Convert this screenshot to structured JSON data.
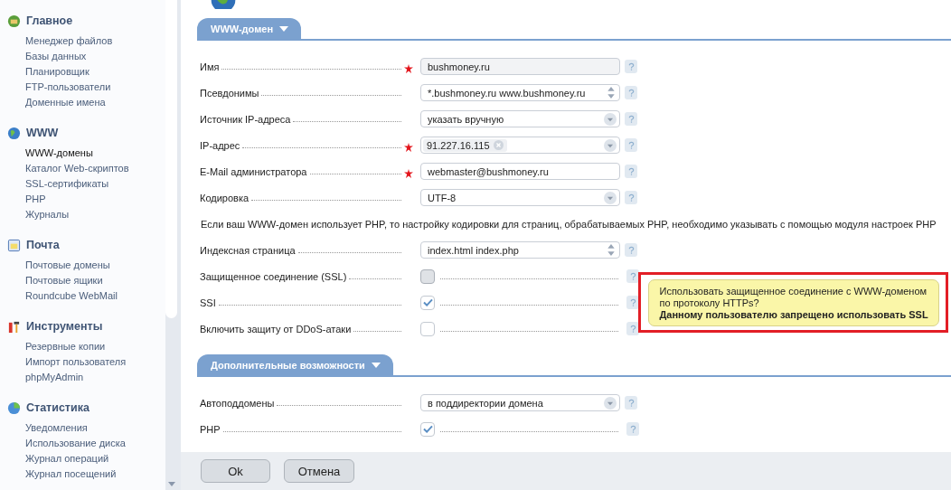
{
  "sidebar": {
    "groups": [
      {
        "title": "Главное",
        "items": [
          {
            "label": "Менеджер файлов",
            "selected": false
          },
          {
            "label": "Базы данных",
            "selected": false
          },
          {
            "label": "Планировщик",
            "selected": false
          },
          {
            "label": "FTP-пользователи",
            "selected": false
          },
          {
            "label": "Доменные имена",
            "selected": false
          }
        ]
      },
      {
        "title": "WWW",
        "items": [
          {
            "label": "WWW-домены",
            "selected": true
          },
          {
            "label": "Каталог Web-скриптов",
            "selected": false
          },
          {
            "label": "SSL-сертификаты",
            "selected": false
          },
          {
            "label": "PHP",
            "selected": false
          },
          {
            "label": "Журналы",
            "selected": false
          }
        ]
      },
      {
        "title": "Почта",
        "items": [
          {
            "label": "Почтовые домены",
            "selected": false
          },
          {
            "label": "Почтовые ящики",
            "selected": false
          },
          {
            "label": "Roundcube WebMail",
            "selected": false
          }
        ]
      },
      {
        "title": "Инструменты",
        "items": [
          {
            "label": "Резервные копии",
            "selected": false
          },
          {
            "label": "Импорт пользователя",
            "selected": false
          },
          {
            "label": "phpMyAdmin",
            "selected": false
          }
        ]
      },
      {
        "title": "Статистика",
        "items": [
          {
            "label": "Уведомления",
            "selected": false
          },
          {
            "label": "Использование диска",
            "selected": false
          },
          {
            "label": "Журнал операций",
            "selected": false
          },
          {
            "label": "Журнал посещений",
            "selected": false
          }
        ]
      }
    ]
  },
  "sections": [
    {
      "title": "WWW-домен",
      "fields": [
        {
          "kind": "text",
          "label": "Имя",
          "required": true,
          "value": "bushmoney.ru",
          "disabled": true
        },
        {
          "kind": "list",
          "label": "Псевдонимы",
          "required": false,
          "value": "*.bushmoney.ru www.bushmoney.ru"
        },
        {
          "kind": "select",
          "label": "Источник IP-адреса",
          "required": false,
          "value": "указать вручную"
        },
        {
          "kind": "tags",
          "label": "IP-адрес",
          "required": true,
          "value": "91.227.16.115"
        },
        {
          "kind": "text",
          "label": "E-Mail администратора",
          "required": true,
          "value": "webmaster@bushmoney.ru",
          "disabled": false
        },
        {
          "kind": "select",
          "label": "Кодировка",
          "required": false,
          "value": "UTF-8"
        },
        {
          "kind": "note",
          "label": "Если ваш WWW-домен использует PHP, то настройку кодировки для страниц, обрабатываемых PHP, необходимо указывать с помощью модуля настроек PHP"
        },
        {
          "kind": "list",
          "label": "Индексная страница",
          "required": false,
          "value": "index.html index.php"
        },
        {
          "kind": "checkbox",
          "label": "Защищенное соединение (SSL)",
          "required": false,
          "checked": false,
          "disabled": true
        },
        {
          "kind": "checkbox",
          "label": "SSI",
          "required": false,
          "checked": true,
          "disabled": false
        },
        {
          "kind": "checkbox",
          "label": "Включить защиту от DDoS-атаки",
          "required": false,
          "checked": false,
          "disabled": false
        }
      ]
    },
    {
      "title": "Дополнительные возможности",
      "fields": [
        {
          "kind": "select",
          "label": "Автоподдомены",
          "required": false,
          "value": "в поддиректории домена"
        },
        {
          "kind": "checkbox",
          "label": "PHP",
          "required": false,
          "checked": true,
          "disabled": false
        }
      ]
    }
  ],
  "tooltip": {
    "text": "Использовать защищенное соединение с WWW-доменом по протоколу HTTPs?",
    "warning": "Данному пользователю запрещено использовать SSL"
  },
  "buttons": [
    "Ok",
    "Отмена"
  ]
}
